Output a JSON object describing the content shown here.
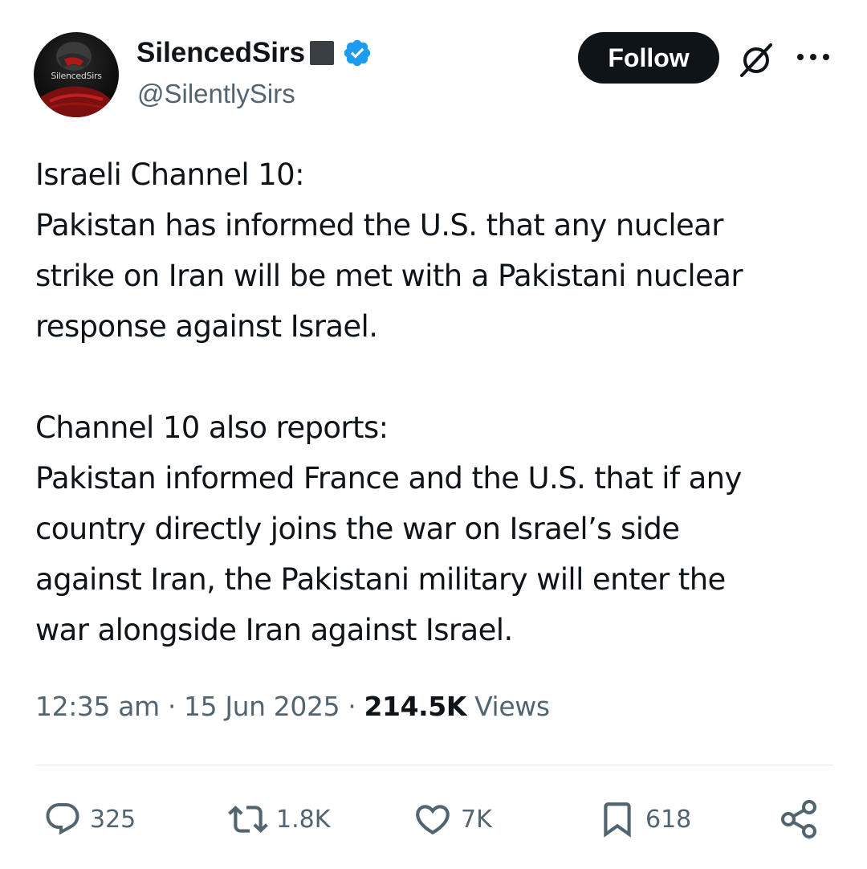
{
  "author": {
    "display_name": "SilencedSirs",
    "handle": "@SilentlySirs",
    "avatar_text": "SilencedSirs",
    "verified_color": "#1d9bf0"
  },
  "header": {
    "follow_label": "Follow",
    "grok_icon": "slashed-circle-icon",
    "more_icon": "more-dots-icon"
  },
  "tweet": {
    "lines": [
      "Israeli Channel 10:",
      "Pakistan has informed the U.S. that any nuclear",
      "strike on Iran will be met with a Pakistani nuclear",
      "response against Israel.",
      "Channel 10 also reports:",
      "Pakistan informed France and the U.S. that if any",
      "country directly joins the war on Israel’s side",
      "against Iran, the Pakistani military will enter the",
      "war alongside Iran against Israel."
    ]
  },
  "meta": {
    "time": "12:35 am",
    "separator": "·",
    "date": "15 Jun 2025",
    "views_count": "214.5K",
    "views_label": "Views"
  },
  "actions": {
    "replies": "325",
    "reposts": "1.8K",
    "likes": "7K",
    "bookmarks": "618"
  },
  "colors": {
    "text_primary": "#0f1419",
    "text_secondary": "#536471",
    "follow_bg": "#0f1419",
    "divider": "#e6e9ec"
  }
}
